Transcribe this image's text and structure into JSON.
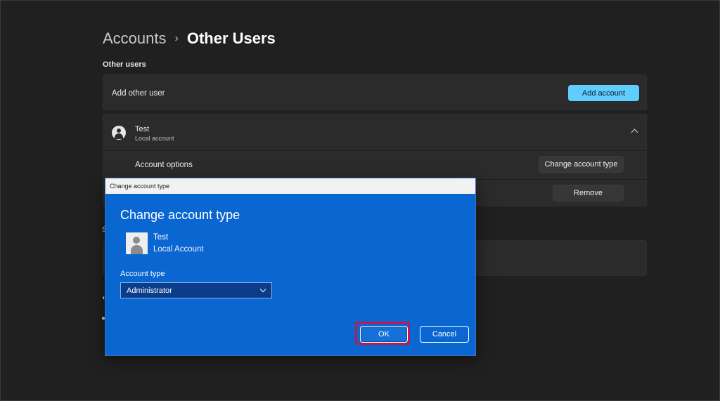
{
  "breadcrumb": {
    "parent": "Accounts",
    "separator": "›",
    "current": "Other Users"
  },
  "other_users_section": {
    "label": "Other users",
    "add_other_user": {
      "label": "Add other user",
      "button": "Add account"
    },
    "user": {
      "name": "Test",
      "type": "Local account",
      "account_options": {
        "label": "Account options",
        "button": "Change account type"
      },
      "remove_button": "Remove"
    }
  },
  "background_fragment": {
    "letter": "S"
  },
  "dialog": {
    "window_title": "Change account type",
    "heading": "Change account type",
    "user_name": "Test",
    "user_type": "Local Account",
    "field_label": "Account type",
    "selected_value": "Administrator",
    "ok_button": "OK",
    "cancel_button": "Cancel"
  },
  "colors": {
    "accent_button": "#60cdff",
    "dialog_background": "#0a66d1",
    "highlight_border": "#c01752"
  },
  "icons": [
    "chevron-right-icon",
    "user-icon",
    "chevron-up-icon",
    "chevron-down-icon",
    "headset-icon",
    "people-icon"
  ]
}
